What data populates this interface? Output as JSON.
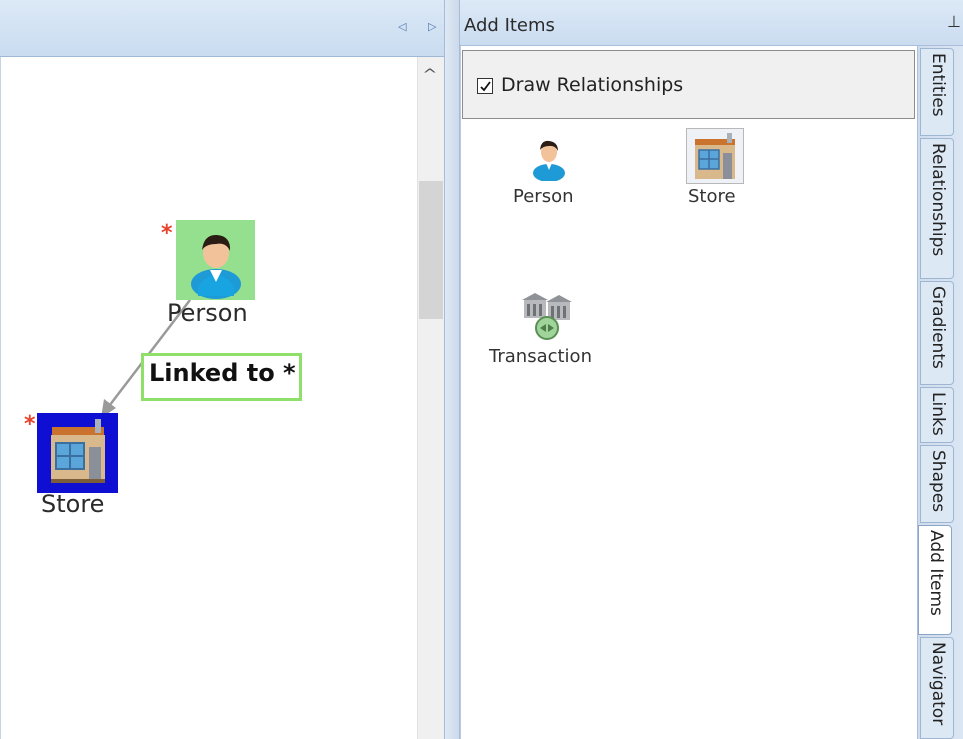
{
  "left_pane": {
    "nav_arrows": "◁ ▷",
    "nodes": {
      "person_label": "Person",
      "store_label": "Store",
      "new_marker": "*"
    },
    "link_label": "Linked to *"
  },
  "right_panel": {
    "title": "Add Items",
    "pin": "⊥",
    "draw_relationships": {
      "label": "Draw Relationships",
      "checked": true
    },
    "items": [
      {
        "label": "Person",
        "icon": "person-icon"
      },
      {
        "label": "Store",
        "icon": "store-icon"
      },
      {
        "label": "Transaction",
        "icon": "transaction-icon"
      }
    ]
  },
  "tabs": [
    {
      "label": "Entities"
    },
    {
      "label": "Relationships"
    },
    {
      "label": "Gradients"
    },
    {
      "label": "Links"
    },
    {
      "label": "Shapes"
    },
    {
      "label": "Add Items",
      "active": true
    },
    {
      "label": "Navigator"
    }
  ],
  "colors": {
    "person_node_bg": "#94e08e",
    "store_node_bg": "#0f0fd4",
    "link_border": "#8fe06a",
    "new_marker": "#e8412a"
  }
}
